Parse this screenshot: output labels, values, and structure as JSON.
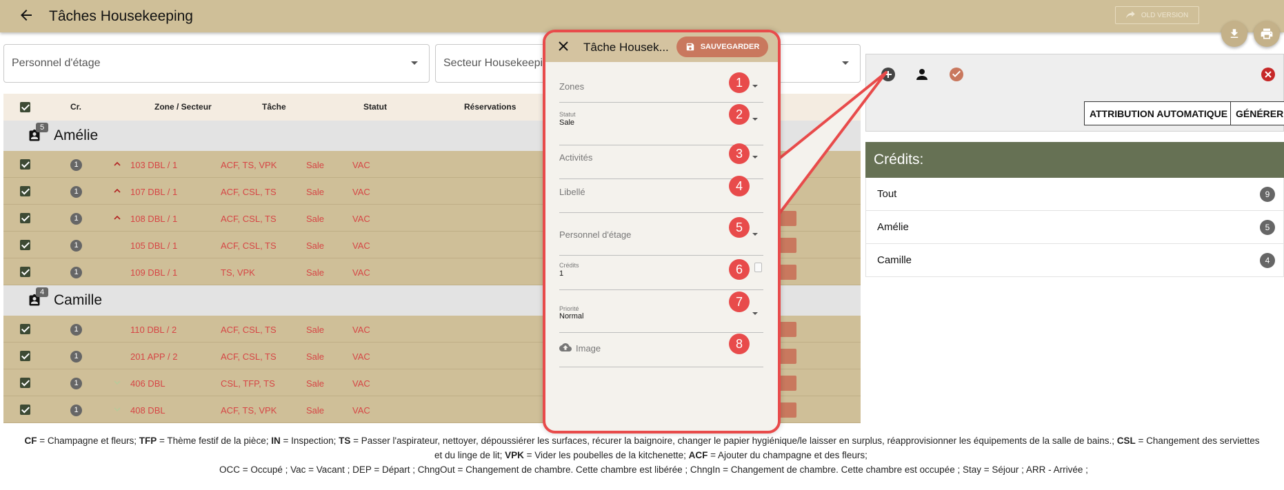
{
  "header": {
    "title": "Tâches Housekeeping",
    "old_version_label": "OLD VERSION"
  },
  "filters": {
    "personnel_label": "Personnel d'étage",
    "secteur_label": "Secteur Housekeepi"
  },
  "table": {
    "columns": [
      "Cr.",
      "Zone / Secteur",
      "Tâche",
      "Statut",
      "Réservations"
    ],
    "groups": [
      {
        "name": "Amélie",
        "count": "5",
        "rows": [
          {
            "cr": "1",
            "priority": "up",
            "zone": "103 DBL / 1",
            "task": "ACF, TS, VPK",
            "status": "Sale",
            "res": "VAC"
          },
          {
            "cr": "1",
            "priority": "up",
            "zone": "107 DBL / 1",
            "task": "ACF, CSL, TS",
            "status": "Sale",
            "res": "VAC"
          },
          {
            "cr": "1",
            "priority": "up",
            "zone": "108 DBL / 1",
            "task": "ACF, CSL, TS",
            "status": "Sale",
            "res": "VAC"
          },
          {
            "cr": "1",
            "priority": "none",
            "zone": "105 DBL / 1",
            "task": "ACF, CSL, TS",
            "status": "Sale",
            "res": "VAC"
          },
          {
            "cr": "1",
            "priority": "none",
            "zone": "109 DBL / 1",
            "task": "TS, VPK",
            "status": "Sale",
            "res": "VAC"
          }
        ]
      },
      {
        "name": "Camille",
        "count": "4",
        "rows": [
          {
            "cr": "1",
            "priority": "none",
            "zone": "110 DBL / 2",
            "task": "ACF, CSL, TS",
            "status": "Sale",
            "res": "VAC"
          },
          {
            "cr": "1",
            "priority": "none",
            "zone": "201 APP / 2",
            "task": "ACF, CSL, TS",
            "status": "Sale",
            "res": "VAC"
          },
          {
            "cr": "1",
            "priority": "down",
            "zone": "406 DBL",
            "task": "CSL, TFP, TS",
            "status": "Sale",
            "res": "VAC"
          },
          {
            "cr": "1",
            "priority": "down",
            "zone": "408 DBL",
            "task": "ACF, TS, VPK",
            "status": "Sale",
            "res": "VAC"
          }
        ]
      }
    ]
  },
  "right_panel": {
    "auto_assign_label": "ATTRIBUTION AUTOMATIQUE",
    "generate_label": "GÉNÉRER"
  },
  "credits": {
    "title": "Crédits:",
    "items": [
      {
        "name": "Tout",
        "count": "9"
      },
      {
        "name": "Amélie",
        "count": "5"
      },
      {
        "name": "Camille",
        "count": "4"
      }
    ]
  },
  "modal": {
    "title": "Tâche Housek...",
    "save_label": "SAUVEGARDER",
    "fields": [
      {
        "label": "Zones",
        "number": "1"
      },
      {
        "label": "Statut",
        "value": "Sale",
        "number": "2"
      },
      {
        "label": "Activités",
        "number": "3"
      },
      {
        "label": "Libellé",
        "number": "4"
      },
      {
        "label": "Personnel d'étage",
        "number": "5"
      },
      {
        "label": "Crédits",
        "value": "1",
        "number": "6"
      },
      {
        "label": "Priorité",
        "value": "Normal",
        "number": "7"
      },
      {
        "label": "Image",
        "number": "8"
      }
    ]
  },
  "legend": {
    "l1_cf": "CF",
    "l1_cf_txt": " = Champagne et fleurs; ",
    "l1_tfp": "TFP",
    "l1_tfp_txt": " = Thème festif de la pièce; ",
    "l1_in": "IN",
    "l1_in_txt": " = Inspection; ",
    "l1_ts": "TS",
    "l1_ts_txt": " = Passer l'aspirateur, nettoyer, dépoussiérer les surfaces, récurer la baignoire, changer le papier hygiénique/le laisser en surplus, réapprovisionner les équipements de la salle de bains.; ",
    "l1_csl": "CSL",
    "l1_csl_txt": " = Changement des serviettes",
    "l2_txt": "et du linge de lit; ",
    "l2_vpk": "VPK",
    "l2_vpk_txt": " = Vider les poubelles de la kitchenette; ",
    "l2_acf": "ACF",
    "l2_acf_txt": " = Ajouter du champagne et des fleurs;",
    "l3": "OCC = Occupé ; Vac = Vacant ; DEP = Départ ; ChngOut = Changement de chambre. Cette chambre est libérée ; ChngIn = Changement de chambre. Cette chambre est occupée ; Stay = Séjour ; ARR - Arrivée ;"
  },
  "colors": {
    "topbar": "#cfbf98",
    "accent_red": "#e84b4b",
    "task_red": "#d64545",
    "credits_header": "#667154",
    "save_button": "#c9785e"
  }
}
